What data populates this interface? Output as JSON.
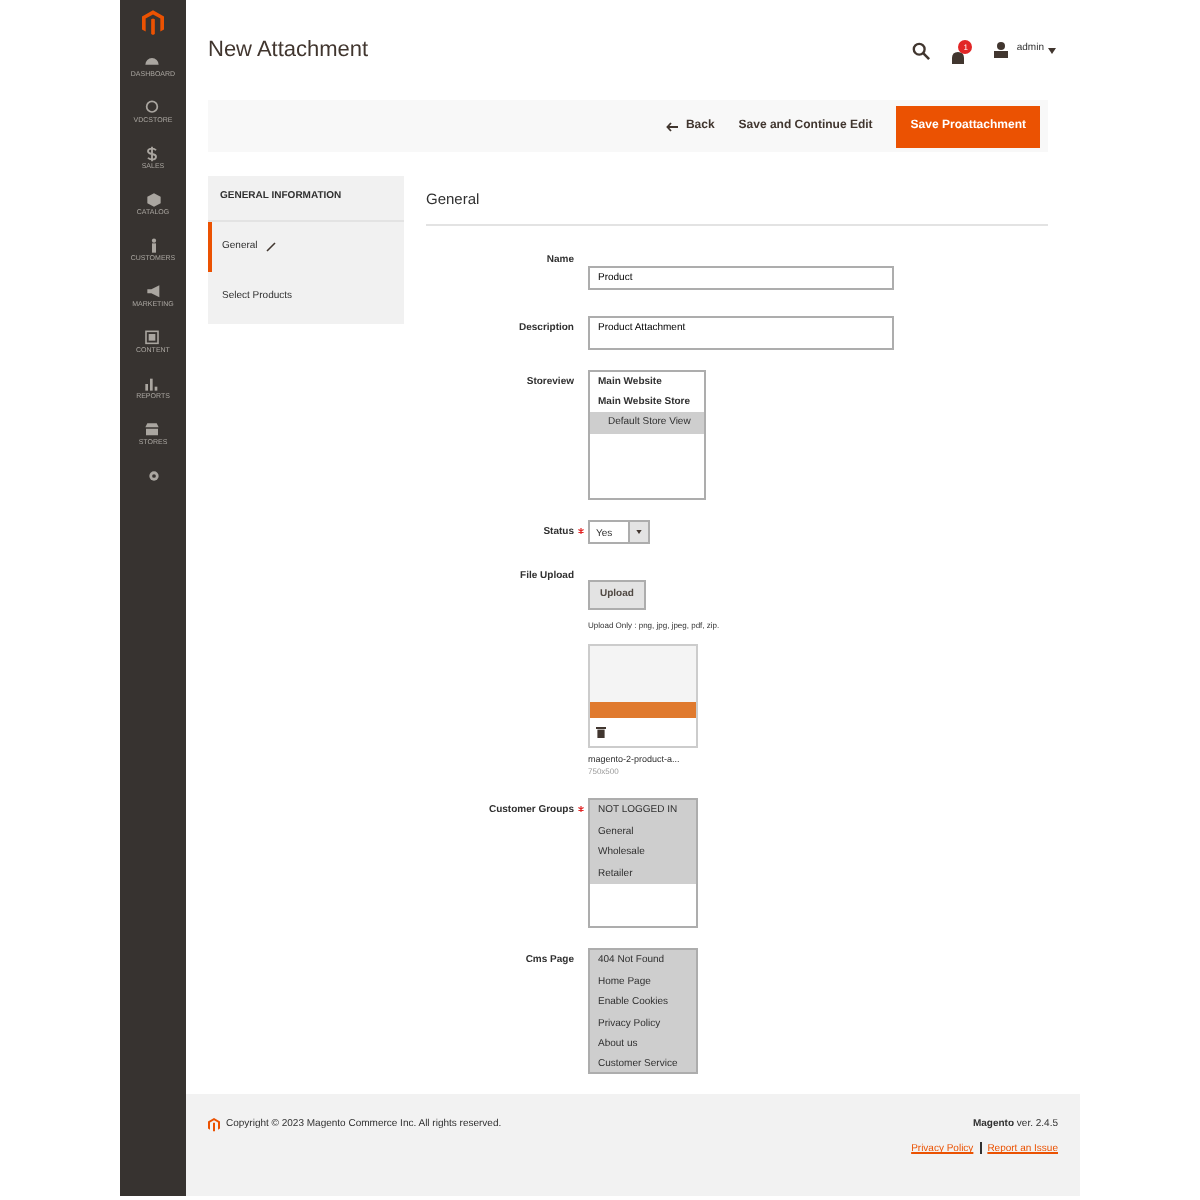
{
  "sidebar": {
    "items": [
      {
        "label": "DASHBOARD"
      },
      {
        "label": "VDCSTORE"
      },
      {
        "label": "SALES"
      },
      {
        "label": "CATALOG"
      },
      {
        "label": "CUSTOMERS"
      },
      {
        "label": "MARKETING"
      },
      {
        "label": "CONTENT"
      },
      {
        "label": "REPORTS"
      },
      {
        "label": "STORES"
      }
    ]
  },
  "header": {
    "title": "New Attachment",
    "notification_count": "1",
    "user": "admin"
  },
  "actions": {
    "back": "Back",
    "save_continue": "Save and Continue Edit",
    "save": "Save Proattachment"
  },
  "tabs": {
    "title": "GENERAL INFORMATION",
    "items": [
      {
        "label": "General",
        "selected": true
      },
      {
        "label": "Select Products",
        "selected": false
      }
    ]
  },
  "form": {
    "title": "General",
    "fields": [
      {
        "kind": "text",
        "label": "Name",
        "required": false,
        "value": "Product"
      },
      {
        "kind": "textarea",
        "label": "Description",
        "required": false,
        "value": "Product Attachment"
      },
      {
        "kind": "multiselect",
        "label": "Storeview",
        "required": false,
        "options": [
          {
            "label": "Main Website",
            "group": true,
            "selected": false
          },
          {
            "label": "Main Website Store",
            "group": true,
            "selected": false
          },
          {
            "label": "Default Store View",
            "group": false,
            "selected": true
          }
        ]
      },
      {
        "kind": "select",
        "label": "Status",
        "required": true,
        "value": "Yes"
      },
      {
        "kind": "upload",
        "label": "File Upload",
        "required": false,
        "button": "Upload",
        "hint": "Upload Only : png, jpg, jpeg, pdf, zip.",
        "file_name": "magento-2-product-a...",
        "file_size": "750x500"
      },
      {
        "kind": "multiselect",
        "label": "Customer Groups",
        "required": true,
        "options": [
          {
            "label": "NOT LOGGED IN",
            "group": false,
            "selected": true
          },
          {
            "label": "General",
            "group": false,
            "selected": true
          },
          {
            "label": "Wholesale",
            "group": false,
            "selected": true
          },
          {
            "label": "Retailer",
            "group": false,
            "selected": true
          }
        ]
      },
      {
        "kind": "multiselect",
        "label": "Cms Page",
        "required": false,
        "options": [
          {
            "label": "404 Not Found",
            "group": false,
            "selected": true
          },
          {
            "label": "Home Page",
            "group": false,
            "selected": true
          },
          {
            "label": "Enable Cookies",
            "group": false,
            "selected": true
          },
          {
            "label": "Privacy Policy",
            "group": false,
            "selected": true
          },
          {
            "label": "About us",
            "group": false,
            "selected": true
          },
          {
            "label": "Customer Service",
            "group": false,
            "selected": true
          }
        ]
      }
    ]
  },
  "footer": {
    "copyright": "Copyright © 2023 Magento Commerce Inc. All rights reserved.",
    "version": "**Magento** ver. 2.4.5",
    "links": [
      "Privacy Policy",
      "Report an Issue"
    ]
  }
}
